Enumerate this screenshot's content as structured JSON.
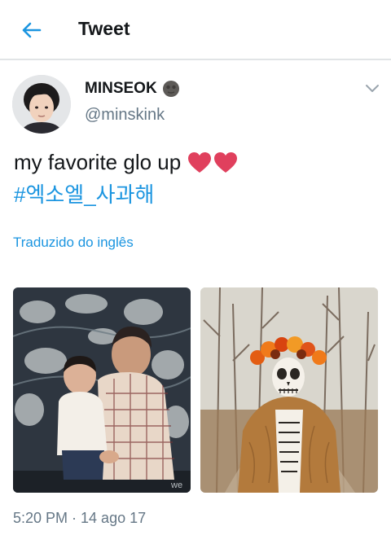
{
  "header": {
    "title": "Tweet"
  },
  "tweet": {
    "display_name": "MINSEOK",
    "handle": "@minskink",
    "text_main": "my favorite glo up",
    "hashtag": "#엑소엘_사과해",
    "translate_label": "Traduzido do inglês",
    "timestamp": "5:20 PM · 14 ago 17"
  },
  "icons": {
    "back": "back-arrow-icon",
    "caret": "chevron-down-icon",
    "name_emoji": "new-moon-face-emoji",
    "hearts": "red-heart-emoji"
  },
  "colors": {
    "accent": "#1b95e0",
    "muted": "#657786",
    "text": "#14171a",
    "divider": "#e1e4e6"
  }
}
